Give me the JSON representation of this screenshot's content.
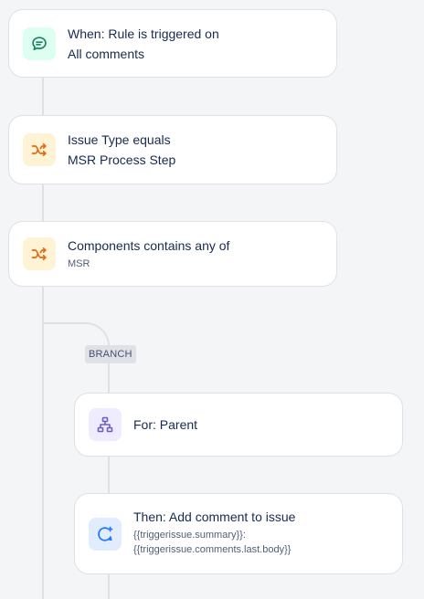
{
  "trigger": {
    "line1": "When: Rule is triggered on",
    "line2": "All comments",
    "icon": "comment-icon",
    "color": "#1f845a"
  },
  "conditions": [
    {
      "line1": "Issue Type equals",
      "line2": "MSR Process Step",
      "icon": "shuffle-icon",
      "color": "#e56910"
    },
    {
      "line1": "Components contains any of",
      "line2": "MSR",
      "icon": "shuffle-icon",
      "color": "#e56910"
    }
  ],
  "branch": {
    "label": "BRANCH",
    "for": {
      "label": "For: Parent",
      "icon": "hierarchy-icon",
      "color": "#6e5dc6"
    },
    "action": {
      "line1": "Then: Add comment to issue",
      "line2": "{{triggerissue.summary}}:",
      "line3": "{{triggerissue.comments.last.body}}",
      "icon": "add-comment-icon",
      "color": "#1d7afc"
    }
  }
}
